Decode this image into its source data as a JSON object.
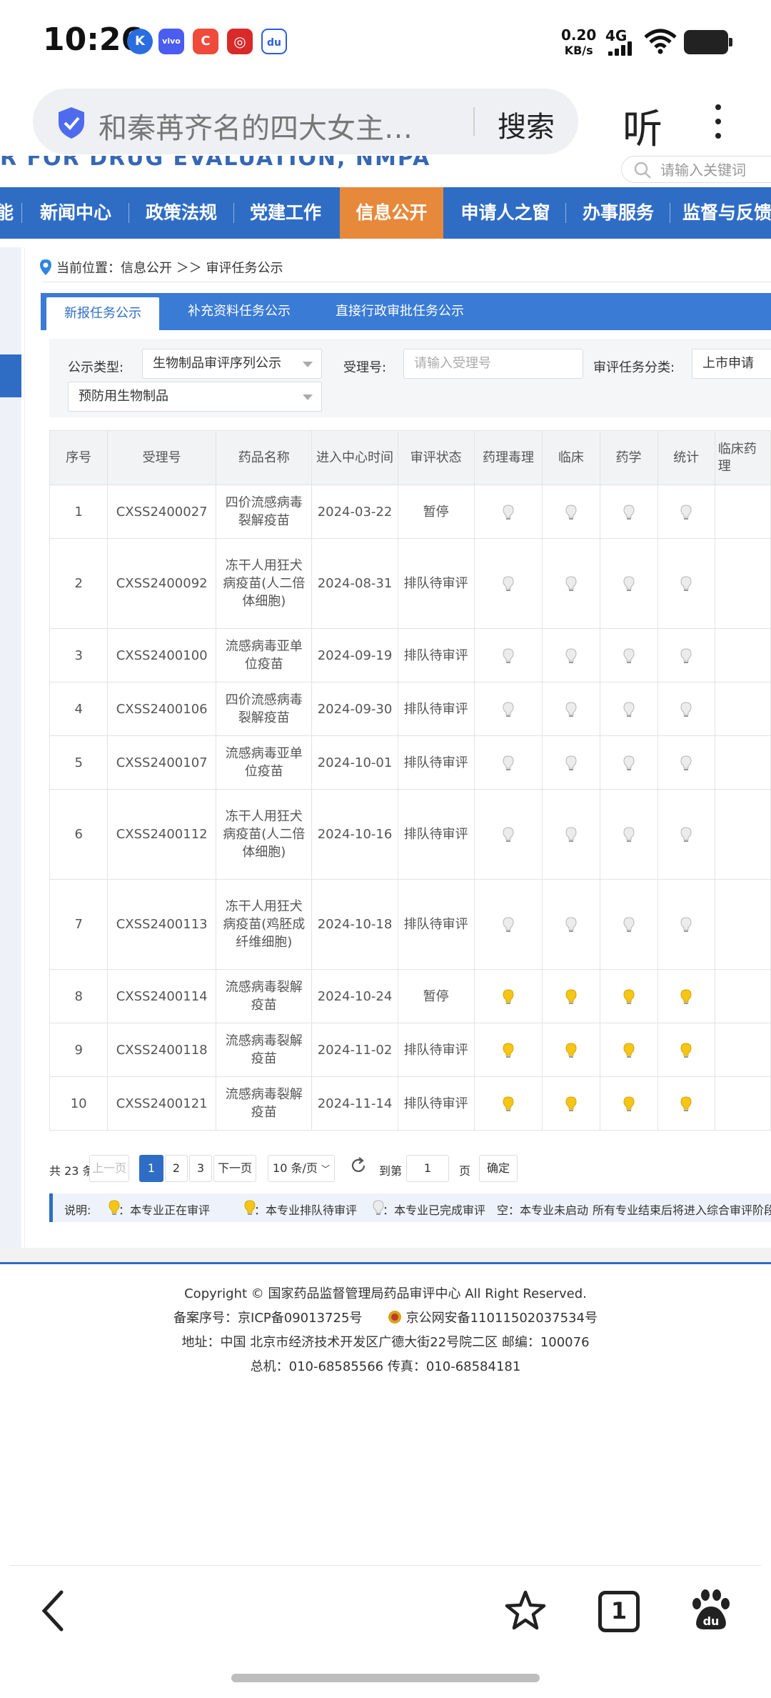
{
  "status_bar": {
    "time": "10:26",
    "net_speed_value": "0.20",
    "net_speed_unit": "KB/s",
    "network": "4G",
    "app_icons": [
      "K",
      "vivo",
      "C",
      "◎",
      "du"
    ]
  },
  "browser": {
    "address_title": "和秦苒齐名的四大女主…",
    "search_button": "搜索",
    "listen_button": "听",
    "tab_count": "1"
  },
  "site": {
    "english_name": "R FOR DRUG EVALUATION, NMPA",
    "search_placeholder": "请输入关键词",
    "nav": [
      "能",
      "新闻中心",
      "政策法规",
      "党建工作",
      "信息公开",
      "申请人之窗",
      "办事服务",
      "监督与反馈"
    ],
    "nav_active": "信息公开"
  },
  "breadcrumb": {
    "text": "当前位置：信息公开 ＞＞ 审评任务公示"
  },
  "tabs": [
    "新报任务公示",
    "补充资料任务公示",
    "直接行政审批任务公示"
  ],
  "filters": {
    "type_label": "公示类型:",
    "type_value": "生物制品审评序列公示",
    "accept_label": "受理号:",
    "accept_placeholder": "请输入受理号",
    "category_label": "审评任务分类:",
    "category_value": "上市申请",
    "sub_value": "预防用生物制品"
  },
  "table": {
    "headers": [
      "序号",
      "受理号",
      "药品名称",
      "进入中心时间",
      "审评状态",
      "药理毒理",
      "临床",
      "药学",
      "统计",
      "临床药理"
    ],
    "rows": [
      {
        "no": "1",
        "id": "CXSS2400027",
        "name": "四价流感病毒裂解疫苗",
        "date": "2024-03-22",
        "status": "暂停",
        "bulb": "done"
      },
      {
        "no": "2",
        "id": "CXSS2400092",
        "name": "冻干人用狂犬病疫苗(人二倍体细胞)",
        "date": "2024-08-31",
        "status": "排队待审评",
        "bulb": "done"
      },
      {
        "no": "3",
        "id": "CXSS2400100",
        "name": "流感病毒亚单位疫苗",
        "date": "2024-09-19",
        "status": "排队待审评",
        "bulb": "done"
      },
      {
        "no": "4",
        "id": "CXSS2400106",
        "name": "四价流感病毒裂解疫苗",
        "date": "2024-09-30",
        "status": "排队待审评",
        "bulb": "done"
      },
      {
        "no": "5",
        "id": "CXSS2400107",
        "name": "流感病毒亚单位疫苗",
        "date": "2024-10-01",
        "status": "排队待审评",
        "bulb": "done"
      },
      {
        "no": "6",
        "id": "CXSS2400112",
        "name": "冻干人用狂犬病疫苗(人二倍体细胞)",
        "date": "2024-10-16",
        "status": "排队待审评",
        "bulb": "done"
      },
      {
        "no": "7",
        "id": "CXSS2400113",
        "name": "冻干人用狂犬病疫苗(鸡胚成纤维细胞)",
        "date": "2024-10-18",
        "status": "排队待审评",
        "bulb": "done"
      },
      {
        "no": "8",
        "id": "CXSS2400114",
        "name": "流感病毒裂解疫苗",
        "date": "2024-10-24",
        "status": "暂停",
        "bulb": "queued"
      },
      {
        "no": "9",
        "id": "CXSS2400118",
        "name": "流感病毒裂解疫苗",
        "date": "2024-11-02",
        "status": "排队待审评",
        "bulb": "queued"
      },
      {
        "no": "10",
        "id": "CXSS2400121",
        "name": "流感病毒裂解疫苗",
        "date": "2024-11-14",
        "status": "排队待审评",
        "bulb": "queued"
      }
    ]
  },
  "pager": {
    "total": "共 23 条",
    "prev": "上一页",
    "pages": [
      "1",
      "2",
      "3"
    ],
    "next": "下一页",
    "page_size": "10 条/页",
    "goto_label": "到第",
    "goto_value": "1",
    "page_unit": "页",
    "confirm": "确定"
  },
  "legend": {
    "title": "说明:",
    "in_review": "：本专业正在审评",
    "queued": "：本专业排队待审评",
    "done": "：本专业已完成审评",
    "empty": "空：本专业未启动",
    "note": "所有专业结束后将进入综合审评阶段。"
  },
  "footer": {
    "copyright": "Copyright © 国家药品监督管理局药品审评中心   All Right Reserved.",
    "icp": "备案序号：京ICP备09013725号",
    "police": "京公网安备11011502037534号",
    "address": "地址：中国 北京市经济技术开发区广德大街22号院二区      邮编：100076",
    "phone": "总机：010-68585566      传真：010-68584181"
  },
  "colors": {
    "nav_blue": "#2f6dc5",
    "nav_active": "#e7893b",
    "bulb_queued": "#f5c518",
    "bulb_done": "#d5d5d5"
  }
}
